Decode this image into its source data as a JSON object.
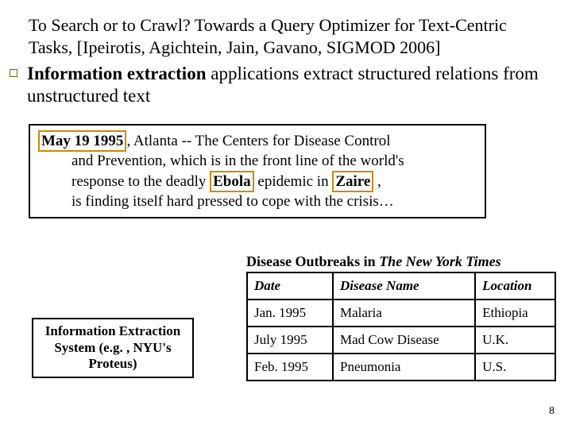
{
  "title": "To Search or to Crawl? Towards a Query Optimizer for Text-Centric Tasks, [Ipeirotis, Agichtein, Jain, Gavano, SIGMOD 2006]",
  "bullet": {
    "lead": "Information extraction",
    "rest": " applications extract structured relations from unstructured text"
  },
  "quote": {
    "date_hl": "May 19 1995",
    "line1_after": ", Atlanta -- The Centers for Disease Control",
    "line2": "and Prevention, which is in the front line of the world's",
    "line3_a": "response to the deadly ",
    "disease_hl": "Ebola",
    "line3_b": " epidemic in ",
    "place_hl": "Zaire",
    "line3_c": " ,",
    "line4": "is finding itself hard pressed to cope with the crisis…"
  },
  "ies_box": "Information Extraction System (e.g. , NYU's Proteus)",
  "table_caption_a": "Disease Outbreaks in ",
  "table_caption_b": "The New York Times",
  "table": {
    "headers": {
      "c0": "Date",
      "c1": "Disease Name",
      "c2": "Location"
    },
    "rows": [
      {
        "c0": "Jan. 1995",
        "c1": "Malaria",
        "c2": "Ethiopia"
      },
      {
        "c0": "July 1995",
        "c1": "Mad Cow Disease",
        "c2": "U.K."
      },
      {
        "c0": "Feb. 1995",
        "c1": "Pneumonia",
        "c2": "U.S."
      }
    ]
  },
  "page_number": "8"
}
